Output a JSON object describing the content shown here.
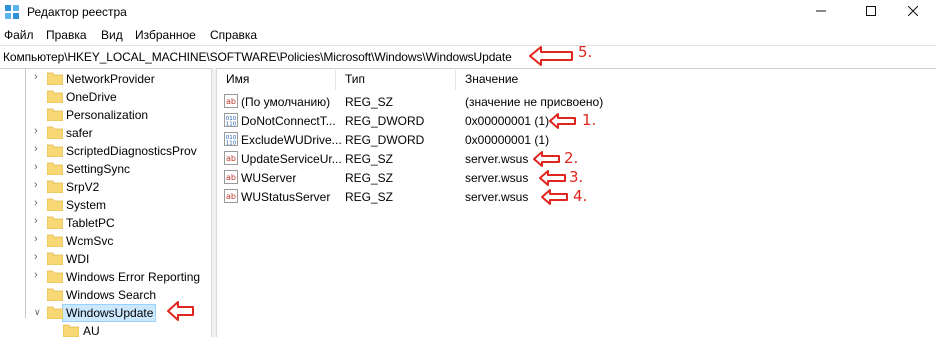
{
  "window": {
    "title": "Редактор реестра"
  },
  "menu": [
    "Файл",
    "Правка",
    "Вид",
    "Избранное",
    "Справка"
  ],
  "address": "Компьютер\\HKEY_LOCAL_MACHINE\\SOFTWARE\\Policies\\Microsoft\\Windows\\WindowsUpdate",
  "tree": [
    {
      "label": "NetworkProvider",
      "expandable": true
    },
    {
      "label": "OneDrive",
      "expandable": false
    },
    {
      "label": "Personalization",
      "expandable": false
    },
    {
      "label": "safer",
      "expandable": true
    },
    {
      "label": "ScriptedDiagnosticsProv",
      "expandable": true
    },
    {
      "label": "SettingSync",
      "expandable": true
    },
    {
      "label": "SrpV2",
      "expandable": true
    },
    {
      "label": "System",
      "expandable": true
    },
    {
      "label": "TabletPC",
      "expandable": true
    },
    {
      "label": "WcmSvc",
      "expandable": true
    },
    {
      "label": "WDI",
      "expandable": true
    },
    {
      "label": "Windows Error Reporting",
      "expandable": true
    },
    {
      "label": "Windows Search",
      "expandable": false
    },
    {
      "label": "WindowsUpdate",
      "expandable": true,
      "expanded": true,
      "selected": true
    },
    {
      "label": "AU",
      "expandable": false,
      "child": true
    }
  ],
  "columns": [
    "Имя",
    "Тип",
    "Значение"
  ],
  "values": [
    {
      "name": "(По умолчанию)",
      "type": "REG_SZ",
      "data": "(значение не присвоено)",
      "icon": "string-value-icon"
    },
    {
      "name": "DoNotConnectT...",
      "type": "REG_DWORD",
      "data": "0x00000001 (1)",
      "icon": "binary-value-icon"
    },
    {
      "name": "ExcludeWUDrive...",
      "type": "REG_DWORD",
      "data": "0x00000001 (1)",
      "icon": "binary-value-icon"
    },
    {
      "name": "UpdateServiceUr...",
      "type": "REG_SZ",
      "data": "server.wsus",
      "icon": "string-value-icon"
    },
    {
      "name": "WUServer",
      "type": "REG_SZ",
      "data": "server.wsus",
      "icon": "string-value-icon"
    },
    {
      "name": "WUStatusServer",
      "type": "REG_SZ",
      "data": "server.wsus",
      "icon": "string-value-icon"
    }
  ],
  "annotations": [
    "1.",
    "2.",
    "3.",
    "4.",
    "5."
  ],
  "colors": {
    "annotation": "#e0261e",
    "selection": "#cce8ff",
    "folder": "#f8d775"
  }
}
